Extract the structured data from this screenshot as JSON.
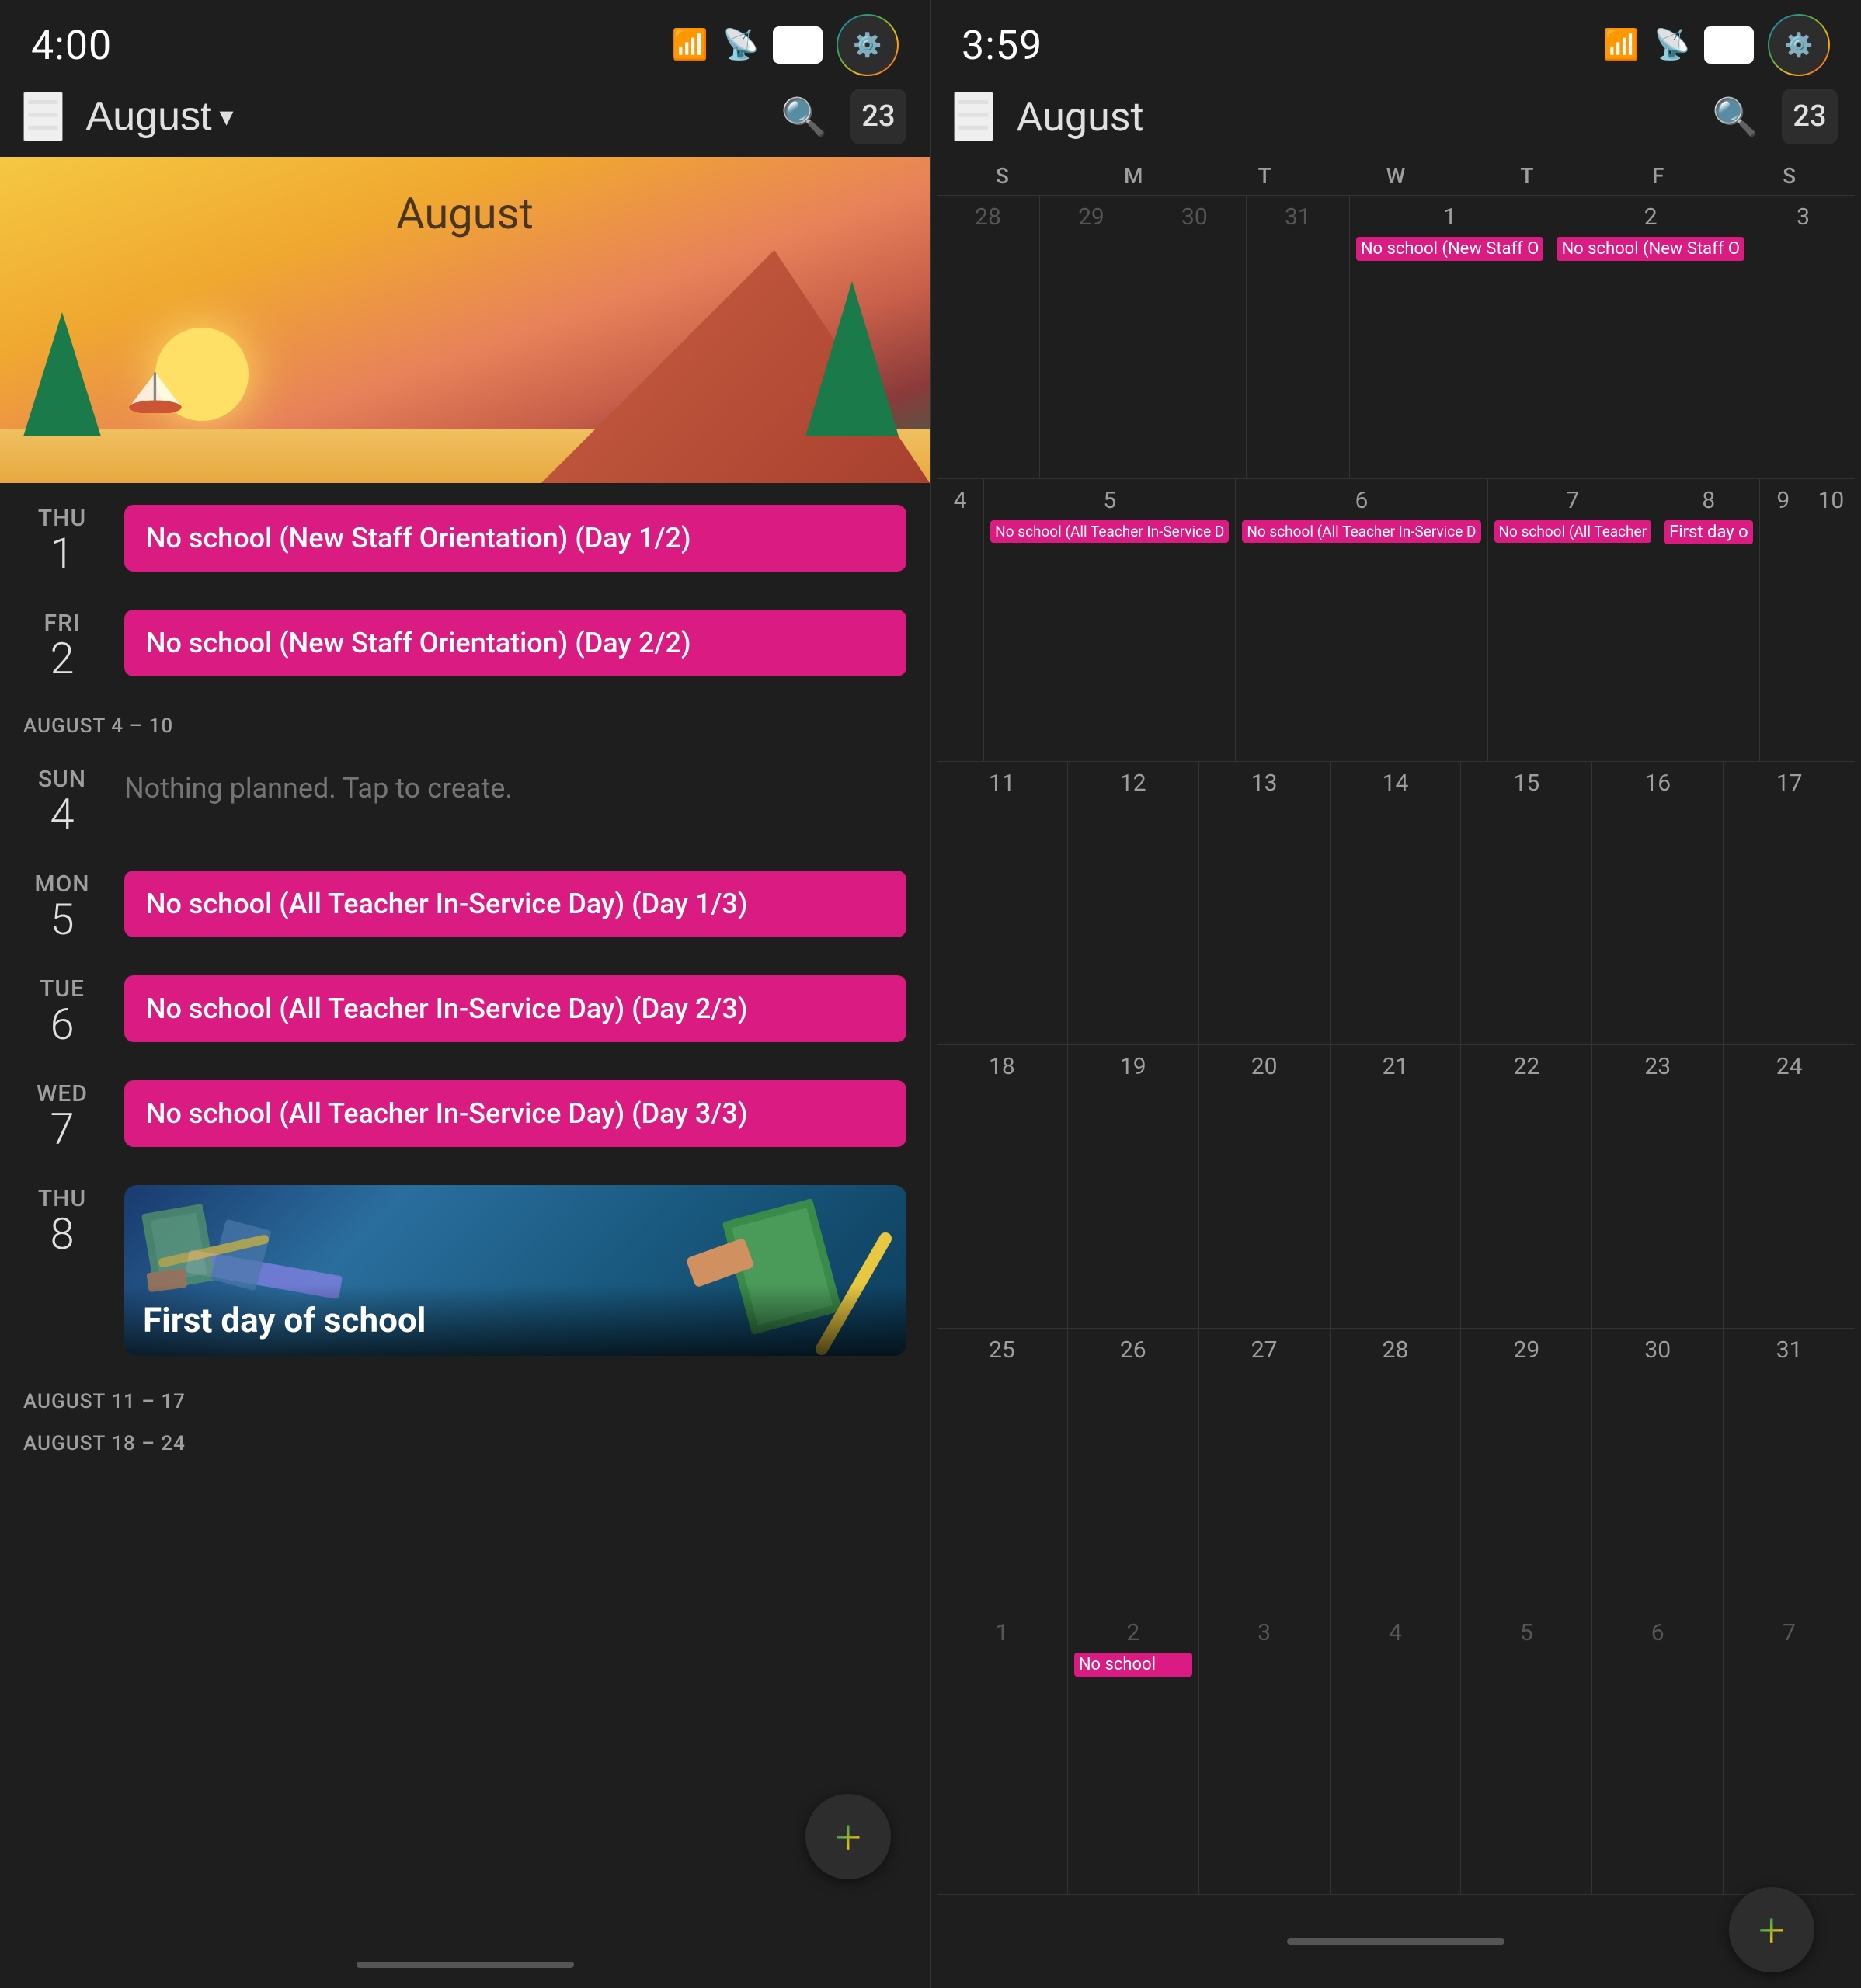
{
  "left": {
    "status": {
      "time": "4:00",
      "battery": "97"
    },
    "header": {
      "menu_label": "☰",
      "month": "August",
      "chevron": "▾",
      "search_label": "🔍",
      "date_badge": "23"
    },
    "hero": {
      "month_label": "August"
    },
    "days": [
      {
        "day_name": "THU",
        "day_num": "1",
        "events": [
          {
            "type": "pink",
            "text": "No school (New Staff Orientation) (Day 1/2)"
          }
        ]
      },
      {
        "day_name": "FRI",
        "day_num": "2",
        "events": [
          {
            "type": "pink",
            "text": "No school (New Staff Orientation) (Day 2/2)"
          }
        ]
      },
      {
        "week_sep": "AUGUST 4 – 10"
      },
      {
        "day_name": "SUN",
        "day_num": "4",
        "events": [
          {
            "type": "nothing",
            "text": "Nothing planned. Tap to create."
          }
        ]
      },
      {
        "day_name": "MON",
        "day_num": "5",
        "events": [
          {
            "type": "pink",
            "text": "No school (All Teacher In-Service Day) (Day 1/3)"
          }
        ]
      },
      {
        "day_name": "TUE",
        "day_num": "6",
        "events": [
          {
            "type": "pink",
            "text": "No school (All Teacher In-Service Day) (Day 2/3)"
          }
        ]
      },
      {
        "day_name": "WED",
        "day_num": "7",
        "events": [
          {
            "type": "pink",
            "text": "No school (All Teacher In-Service Day) (Day 3/3)"
          }
        ]
      },
      {
        "day_name": "THU",
        "day_num": "8",
        "events": [
          {
            "type": "image",
            "text": "First day of school"
          }
        ]
      }
    ],
    "after_seps": [
      "AUGUST 11 – 17",
      "AUGUST 18 – 24"
    ],
    "fab_label": "+"
  },
  "right": {
    "status": {
      "time": "3:59",
      "battery": "97"
    },
    "header": {
      "menu_label": "☰",
      "month": "August",
      "search_label": "🔍",
      "date_badge": "23"
    },
    "weekdays": [
      "S",
      "M",
      "T",
      "W",
      "T",
      "F",
      "S"
    ],
    "weeks": [
      {
        "cells": [
          {
            "num": "28",
            "dim": true,
            "events": []
          },
          {
            "num": "29",
            "dim": true,
            "events": []
          },
          {
            "num": "30",
            "dim": true,
            "events": []
          },
          {
            "num": "31",
            "dim": true,
            "events": []
          },
          {
            "num": "1",
            "today": false,
            "events": [
              {
                "type": "pink",
                "text": "No school (New Staff O"
              }
            ]
          },
          {
            "num": "2",
            "events": [
              {
                "type": "pink",
                "text": "No school (New Staff O"
              }
            ]
          },
          {
            "num": "3",
            "events": []
          }
        ]
      },
      {
        "cells": [
          {
            "num": "4",
            "events": []
          },
          {
            "num": "5",
            "events": [
              {
                "type": "pink",
                "text": "No school (All Teacher In-Service D"
              }
            ]
          },
          {
            "num": "6",
            "events": [
              {
                "type": "pink",
                "text": "No school (All Teacher In-Service D"
              }
            ]
          },
          {
            "num": "7",
            "events": [
              {
                "type": "pink",
                "text": "No school (All Teacher"
              }
            ]
          },
          {
            "num": "8",
            "events": [
              {
                "type": "pink",
                "text": "First day o"
              }
            ]
          },
          {
            "num": "9",
            "events": []
          },
          {
            "num": "10",
            "events": []
          }
        ]
      },
      {
        "cells": [
          {
            "num": "11",
            "events": []
          },
          {
            "num": "12",
            "events": []
          },
          {
            "num": "13",
            "events": []
          },
          {
            "num": "14",
            "events": []
          },
          {
            "num": "15",
            "events": []
          },
          {
            "num": "16",
            "events": []
          },
          {
            "num": "17",
            "events": []
          }
        ]
      },
      {
        "cells": [
          {
            "num": "18",
            "events": []
          },
          {
            "num": "19",
            "events": []
          },
          {
            "num": "20",
            "events": []
          },
          {
            "num": "21",
            "events": []
          },
          {
            "num": "22",
            "events": []
          },
          {
            "num": "23",
            "events": []
          },
          {
            "num": "24",
            "events": []
          }
        ]
      },
      {
        "cells": [
          {
            "num": "25",
            "events": []
          },
          {
            "num": "26",
            "events": []
          },
          {
            "num": "27",
            "events": []
          },
          {
            "num": "28",
            "events": []
          },
          {
            "num": "29",
            "events": []
          },
          {
            "num": "30",
            "events": []
          },
          {
            "num": "31",
            "events": []
          }
        ]
      },
      {
        "cells": [
          {
            "num": "1",
            "dim": true,
            "events": []
          },
          {
            "num": "2",
            "dim": true,
            "events": [
              {
                "type": "pink",
                "text": "No school"
              }
            ]
          },
          {
            "num": "3",
            "dim": true,
            "events": []
          },
          {
            "num": "4",
            "dim": true,
            "events": []
          },
          {
            "num": "5",
            "dim": true,
            "events": []
          },
          {
            "num": "6",
            "dim": true,
            "events": []
          },
          {
            "num": "7",
            "dim": true,
            "events": []
          }
        ]
      }
    ],
    "fab_label": "+"
  }
}
